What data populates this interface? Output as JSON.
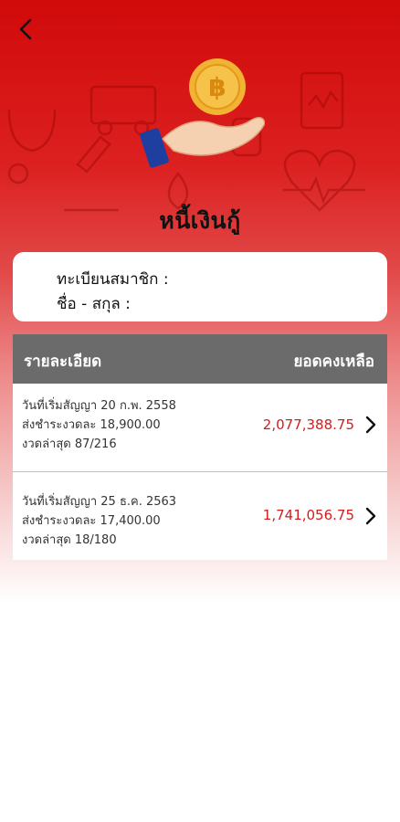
{
  "header": {
    "title": "หนี้เงินกู้"
  },
  "member": {
    "register_label": "ทะเบียนสมาชิก :",
    "name_label": "ชื่อ - สกุล :"
  },
  "table": {
    "col_detail": "รายละเอียด",
    "col_balance": "ยอดคงเหลือ"
  },
  "loans": [
    {
      "start_date": "วันที่เริ่มสัญญา 20 ก.พ. 2558",
      "installment": "ส่งชำระงวดละ 18,900.00",
      "latest": "งวดล่าสุด 87/216",
      "balance": "2,077,388.75"
    },
    {
      "start_date": "วันที่เริ่มสัญญา 25 ธ.ค. 2563",
      "installment": "ส่งชำระงวดละ 17,400.00",
      "latest": "งวดล่าสุด 18/180",
      "balance": "1,741,056.75"
    }
  ],
  "icons": {
    "back": "chevron-left-icon",
    "coin": "baht-coin-icon",
    "hand": "open-hand-icon",
    "row_arrow": "chevron-right-icon"
  },
  "colors": {
    "brand_red": "#d10a0a",
    "amount_red": "#d41c1c",
    "header_gray": "#6b6b6b",
    "coin_gold": "#f2b233"
  }
}
